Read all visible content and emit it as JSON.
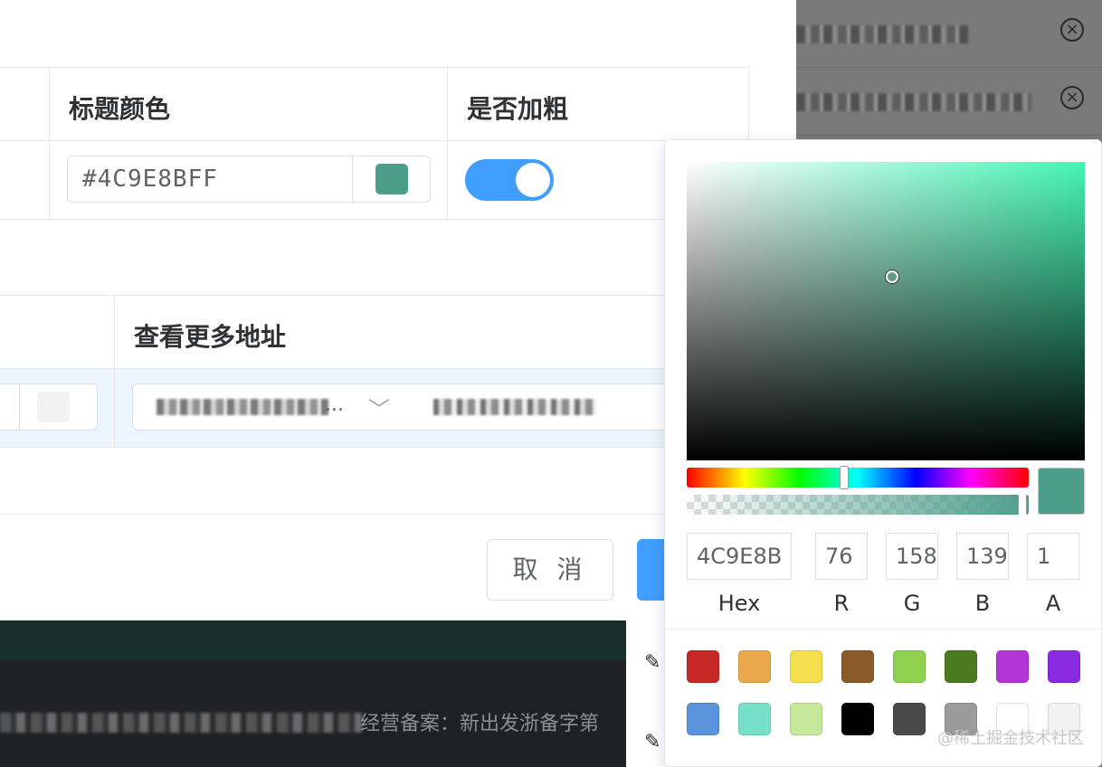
{
  "table1": {
    "headers": [
      "标题颜色",
      "是否加粗"
    ],
    "color_value": "#4C9E8BFF",
    "swatch_color": "#4C9E8B",
    "bold_switch_on": true,
    "switch_color": "#409eff"
  },
  "table2": {
    "header": "查看更多地址",
    "select_ellipsis": "...",
    "row_highlight": "#ecf5ff"
  },
  "footer": {
    "cancel_label": "取 消",
    "confirm_color": "#409eff",
    "icp_text": "经营备案：新出发浙备字第"
  },
  "picker": {
    "hue_color": "#46f5b8",
    "current_color": "#4C9E8B",
    "hue_position": 0.46,
    "alpha_position": 1.0,
    "fields": [
      {
        "label": "Hex",
        "value": "4C9E8B"
      },
      {
        "label": "R",
        "value": "76"
      },
      {
        "label": "G",
        "value": "158"
      },
      {
        "label": "B",
        "value": "139"
      },
      {
        "label": "A",
        "value": "1"
      }
    ],
    "presets": [
      "#c62828",
      "#eaa84a",
      "#f4e04d",
      "#8a5a2b",
      "#8fd14f",
      "#4b7a1f",
      "#b334d6",
      "#8a2be2",
      "#5b94dc",
      "#76e0c8",
      "#c6e89a",
      "#000000",
      "#4a4a4a",
      "#9b9b9b",
      "#ffffff",
      "#f2f2f2"
    ]
  },
  "watermark": "@稀土掘金技术社区"
}
